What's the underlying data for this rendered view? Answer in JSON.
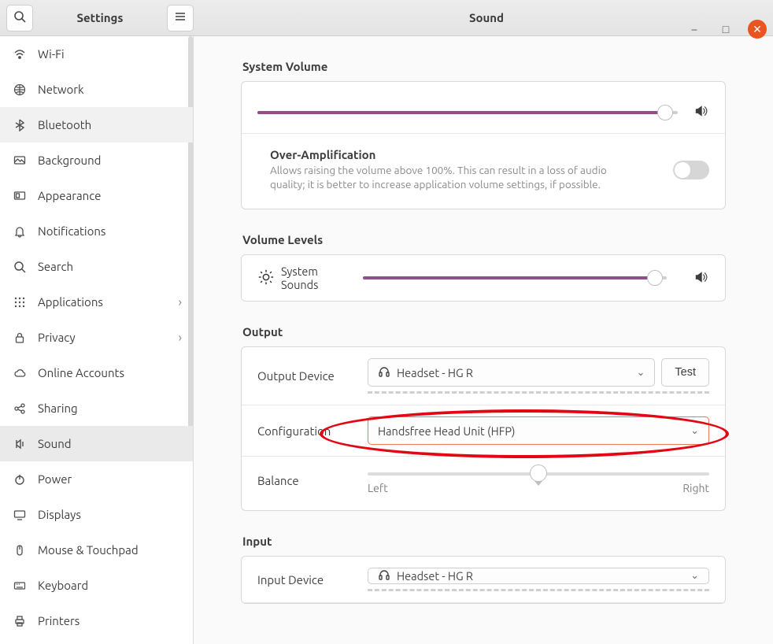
{
  "header": {
    "app_title": "Settings",
    "page_title": "Sound"
  },
  "sidebar": {
    "items": [
      {
        "label": "Wi-Fi"
      },
      {
        "label": "Network"
      },
      {
        "label": "Bluetooth"
      },
      {
        "label": "Background"
      },
      {
        "label": "Appearance"
      },
      {
        "label": "Notifications"
      },
      {
        "label": "Search"
      },
      {
        "label": "Applications",
        "expandable": true
      },
      {
        "label": "Privacy",
        "expandable": true
      },
      {
        "label": "Online Accounts"
      },
      {
        "label": "Sharing"
      },
      {
        "label": "Sound",
        "active": true
      },
      {
        "label": "Power"
      },
      {
        "label": "Displays"
      },
      {
        "label": "Mouse & Touchpad"
      },
      {
        "label": "Keyboard"
      },
      {
        "label": "Printers"
      }
    ]
  },
  "sections": {
    "system_volume_heading": "System Volume",
    "system_volume_percent": 97,
    "over_amp_title": "Over-Amplification",
    "over_amp_desc": "Allows raising the volume above 100%. This can result in a loss of audio quality; it is better to increase application volume settings, if possible.",
    "over_amp_enabled": false,
    "volume_levels_heading": "Volume Levels",
    "vol_levels": {
      "system_sounds_label": "System Sounds",
      "system_sounds_percent": 96
    },
    "output_heading": "Output",
    "output": {
      "device_label": "Output Device",
      "device_value": "Headset - HG R",
      "test_label": "Test",
      "config_label": "Configuration",
      "config_value": "Handsfree Head Unit (HFP)",
      "balance_label": "Balance",
      "balance_left": "Left",
      "balance_right": "Right",
      "balance_value": 50
    },
    "input_heading": "Input",
    "input": {
      "device_label": "Input Device",
      "device_value": "Headset - HG R"
    }
  }
}
